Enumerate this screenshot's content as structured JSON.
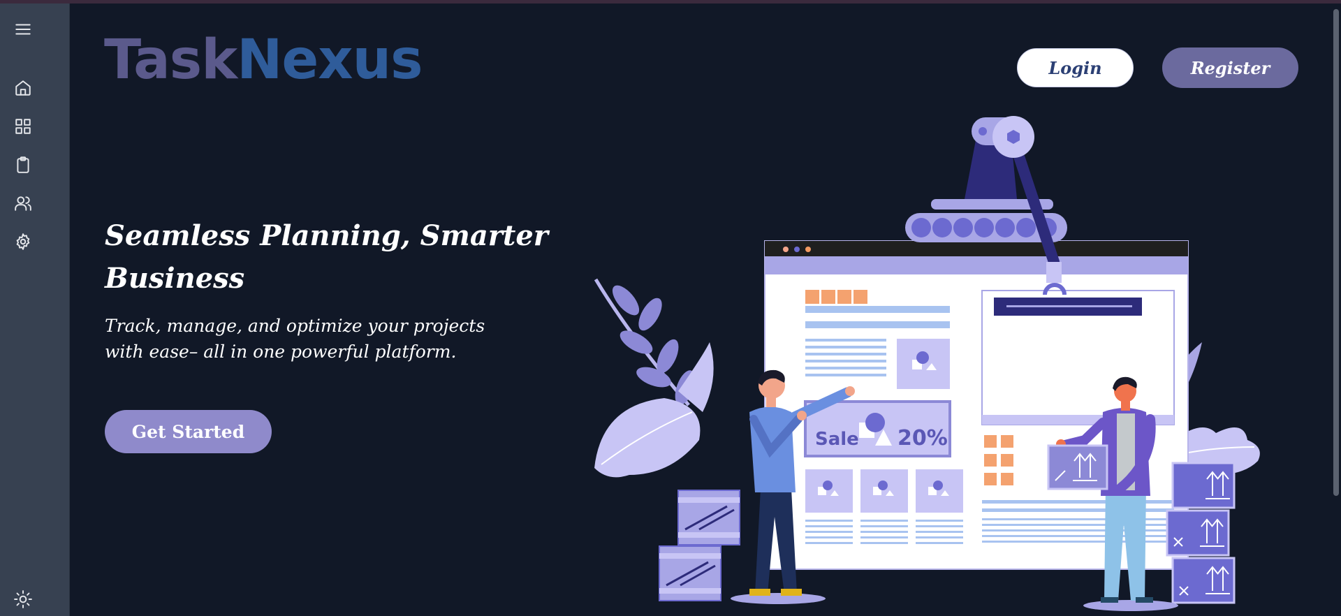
{
  "brand": {
    "part1": "Task",
    "part2": "Nexus"
  },
  "header": {
    "login_label": "Login",
    "register_label": "Register"
  },
  "hero": {
    "headline": "Seamless Planning, Smarter Business",
    "subtext": "Track, manage, and optimize your projects with ease– all in one powerful platform.",
    "cta_label": "Get Started"
  },
  "illustration": {
    "sale_label": "Sale",
    "sale_percent": "20%"
  },
  "sidebar": {
    "items": [
      {
        "icon": "menu-icon"
      },
      {
        "icon": "home-icon"
      },
      {
        "icon": "dashboard-icon"
      },
      {
        "icon": "clipboard-icon"
      },
      {
        "icon": "users-icon"
      },
      {
        "icon": "settings-icon"
      }
    ],
    "theme_icon": "sun-icon"
  },
  "colors": {
    "background": "#111827",
    "sidebar": "#374151",
    "brand_task": "#5b5a8c",
    "brand_nexus": "#2f5c9a",
    "register_bg": "#6b6a9e",
    "cta_bg": "#8f8acb"
  }
}
